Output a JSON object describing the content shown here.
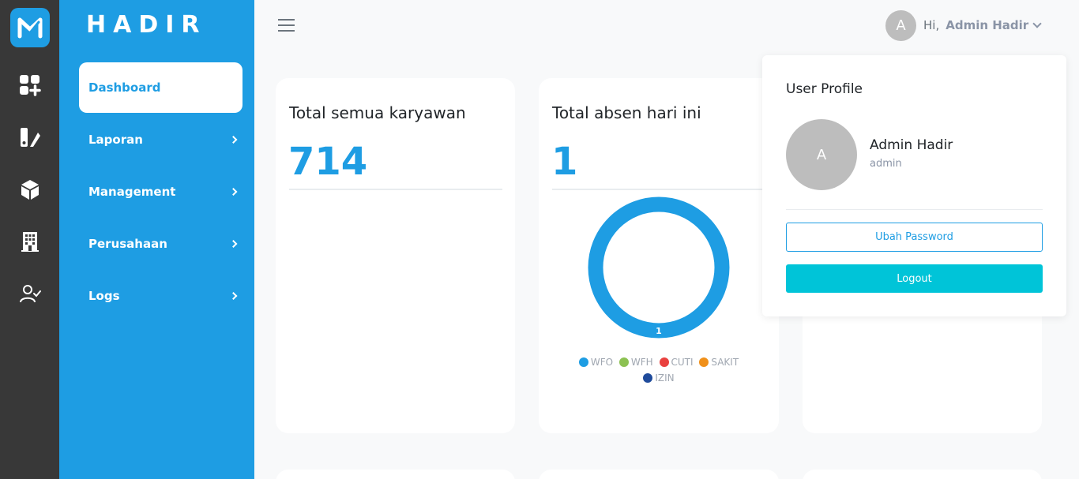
{
  "brand": "HADIR",
  "sidebar": {
    "items": [
      {
        "label": "Dashboard"
      },
      {
        "label": "Laporan"
      },
      {
        "label": "Management"
      },
      {
        "label": "Perusahaan"
      },
      {
        "label": "Logs"
      }
    ]
  },
  "header": {
    "avatar_initial": "A",
    "greeting": "Hi,",
    "user_name": "Admin Hadir"
  },
  "cards": [
    {
      "title": "Total semua karyawan",
      "value": "714"
    },
    {
      "title": "Total absen hari ini",
      "value": "1"
    }
  ],
  "chart_data": {
    "type": "pie",
    "categories": [
      "WFO",
      "WFH",
      "CUTI",
      "SAKIT",
      "IZIN"
    ],
    "values": [
      1,
      0,
      0,
      0,
      0
    ],
    "data_label": "1",
    "colors": [
      "#1e9de3",
      "#8cc152",
      "#e9413f",
      "#f0901a",
      "#1f4b9b"
    ]
  },
  "profile": {
    "title": "User Profile",
    "avatar_initial": "A",
    "name": "Admin Hadir",
    "role": "admin",
    "change_password_label": "Ubah Password",
    "logout_label": "Logout"
  },
  "colors": {
    "primary": "#1e9de3",
    "rail": "#383838",
    "logout": "#00c4d8"
  }
}
